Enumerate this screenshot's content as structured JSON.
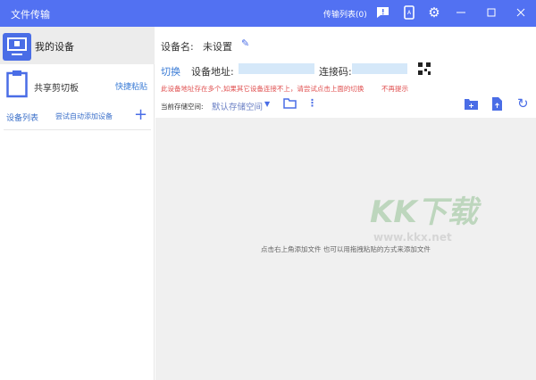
{
  "titlebar": {
    "title": "文件传输",
    "transfer_list": "传输列表(0)",
    "icons": [
      "feedback-icon",
      "phone-icon",
      "gear-icon",
      "minimize-icon",
      "maximize-icon",
      "close-icon"
    ]
  },
  "sidebar": {
    "my_device": "我的设备",
    "clipboard": "共享剪切板",
    "quick_paste": "快捷粘贴",
    "device_list": "设备列表",
    "auto_add": "尝试自动添加设备"
  },
  "main": {
    "device_name_label": "设备名:",
    "device_name": "未设置",
    "switch": "切换",
    "address_label": "设备地址:",
    "code_label": "连接码:",
    "warning": "此设备地址存在多个,如果其它设备连接不上，请尝试点击上面的切换",
    "no_remind": "不再提示",
    "storage_label": "当前存储空间:",
    "storage_value": "默认存储空间",
    "empty_hint": "点击右上角添加文件 也可以用拖拽粘贴的方式来添加文件"
  },
  "watermark": {
    "logo": "KK下载",
    "url": "www.kkx.net"
  },
  "colors": {
    "accent": "#5271f2",
    "warning": "#e05050",
    "link": "#3a7bd5"
  }
}
